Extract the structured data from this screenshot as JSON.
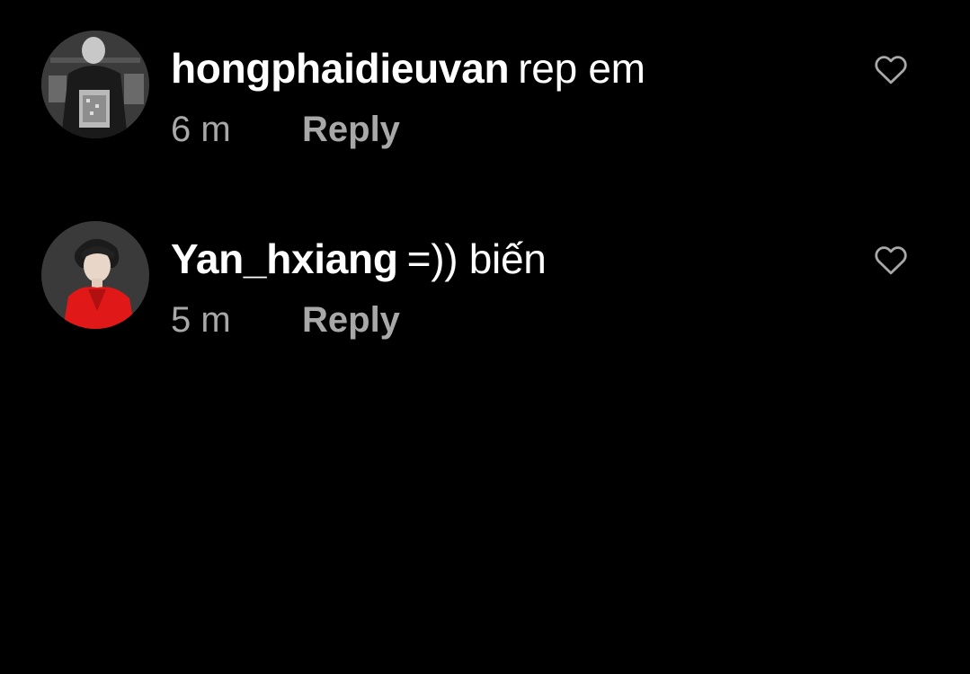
{
  "comments": [
    {
      "username": "hongphaidieuvan",
      "text": "rep em",
      "time": "6 m",
      "reply_label": "Reply",
      "avatar_icon": "user-avatar-dark-outfit",
      "like_icon": "heart-outline-icon"
    },
    {
      "username": "Yan_hxiang",
      "text": "=)) biến",
      "time": "5 m",
      "reply_label": "Reply",
      "avatar_icon": "user-avatar-red-jacket",
      "like_icon": "heart-outline-icon"
    }
  ],
  "colors": {
    "background": "#000000",
    "primary_text": "#ffffff",
    "secondary_text": "#a8a8a8",
    "avatar2_accent": "#e01818"
  }
}
